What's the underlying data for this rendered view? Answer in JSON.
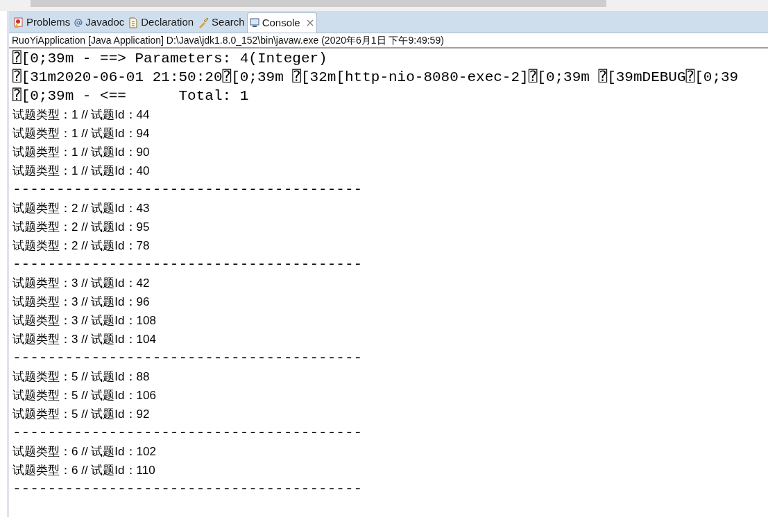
{
  "tabs": [
    {
      "label": "Problems",
      "kind": "problems",
      "selected": false
    },
    {
      "label": "Javadoc",
      "kind": "javadoc",
      "selected": false
    },
    {
      "label": "Declaration",
      "kind": "declaration",
      "selected": false
    },
    {
      "label": "Search",
      "kind": "search",
      "selected": false
    },
    {
      "label": "Console",
      "kind": "console",
      "selected": true
    }
  ],
  "console": {
    "title": "RuoYiApplication [Java Application] D:\\Java\\jdk1.8.0_152\\bin\\javaw.exe (2020年6月1日 下午9:49:59)",
    "lines": [
      {
        "kind": "mono",
        "text": "⍰[0;39m - ==> Parameters: 4(Integer)"
      },
      {
        "kind": "mono",
        "text": "⍰[31m2020-06-01 21:50:20⍰[0;39m ⍰[32m[http-nio-8080-exec-2]⍰[0;39m ⍰[39mDEBUG⍰[0;39"
      },
      {
        "kind": "mono",
        "text": "⍰[0;39m - <==      Total: 1"
      },
      {
        "kind": "text",
        "text": "试题类型：1 // 试题Id：44"
      },
      {
        "kind": "text",
        "text": "试题类型：1 // 试题Id：94"
      },
      {
        "kind": "text",
        "text": "试题类型：1 // 试题Id：90"
      },
      {
        "kind": "text",
        "text": "试题类型：1 // 试题Id：40"
      },
      {
        "kind": "mono",
        "text": "----------------------------------------"
      },
      {
        "kind": "text",
        "text": "试题类型：2 // 试题Id：43"
      },
      {
        "kind": "text",
        "text": "试题类型：2 // 试题Id：95"
      },
      {
        "kind": "text",
        "text": "试题类型：2 // 试题Id：78"
      },
      {
        "kind": "mono",
        "text": "----------------------------------------"
      },
      {
        "kind": "text",
        "text": "试题类型：3 // 试题Id：42"
      },
      {
        "kind": "text",
        "text": "试题类型：3 // 试题Id：96"
      },
      {
        "kind": "text",
        "text": "试题类型：3 // 试题Id：108"
      },
      {
        "kind": "text",
        "text": "试题类型：3 // 试题Id：104"
      },
      {
        "kind": "mono",
        "text": "----------------------------------------"
      },
      {
        "kind": "text",
        "text": "试题类型：5 // 试题Id：88"
      },
      {
        "kind": "text",
        "text": "试题类型：5 // 试题Id：106"
      },
      {
        "kind": "text",
        "text": "试题类型：5 // 试题Id：92"
      },
      {
        "kind": "mono",
        "text": "----------------------------------------"
      },
      {
        "kind": "text",
        "text": "试题类型：6 // 试题Id：102"
      },
      {
        "kind": "text",
        "text": "试题类型：6 // 试题Id：110"
      },
      {
        "kind": "mono",
        "text": "----------------------------------------"
      }
    ]
  }
}
